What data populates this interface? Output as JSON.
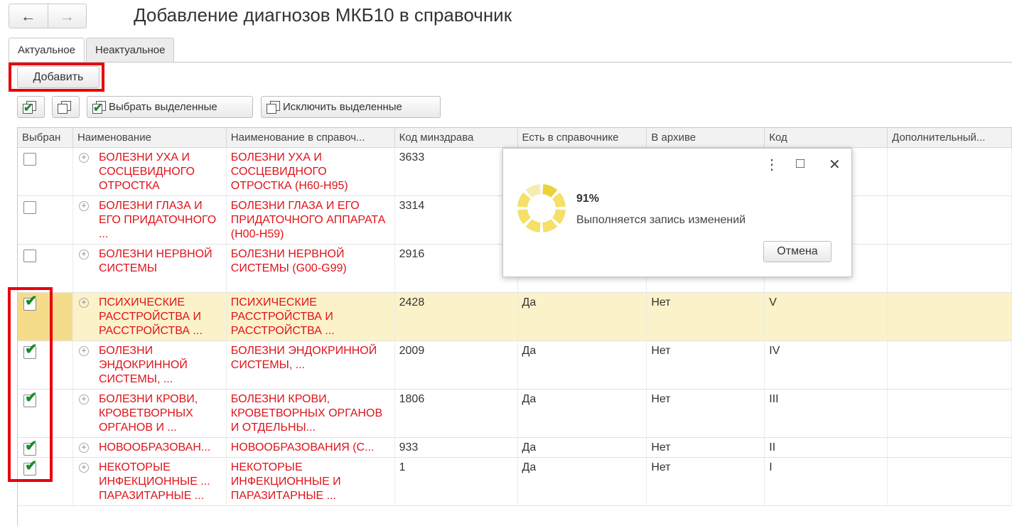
{
  "window": {
    "title": "Добавление диагнозов МКБ10 в справочник",
    "back_icon": "←",
    "forward_icon": "→"
  },
  "tabs": [
    {
      "label": "Актуальное"
    },
    {
      "label": "Неактуальное"
    }
  ],
  "toolbar": {
    "add_label": "Добавить",
    "select_selected_label": "Выбрать выделенные",
    "exclude_selected_label": "Исключить выделенные"
  },
  "columns": [
    "Выбран",
    "Наименование",
    "Наименование в справоч...",
    "Код минздрава",
    "Есть в справочнике",
    "В архиве",
    "Код",
    "Дополнительный..."
  ],
  "rows": [
    {
      "checked": false,
      "name": "БОЛЕЗНИ УХА И СОСЦЕВИДНОГО ОТРОСТКА",
      "ref_name": "БОЛЕЗНИ УХА И СОСЦЕВИДНОГО ОТРОСТКА (H60-H95)",
      "mz_code": "3633",
      "in_ref": "",
      "archive": "",
      "code": ""
    },
    {
      "checked": false,
      "name": "БОЛЕЗНИ ГЛАЗА И ЕГО ПРИДАТОЧНОГО ...",
      "ref_name": "БОЛЕЗНИ ГЛАЗА И ЕГО ПРИДАТОЧНОГО АППАРАТА (H00-H59)",
      "mz_code": "3314",
      "in_ref": "",
      "archive": "",
      "code": ""
    },
    {
      "checked": false,
      "name": "БОЛЕЗНИ НЕРВНОЙ СИСТЕМЫ",
      "ref_name": "БОЛЕЗНИ НЕРВНОЙ СИСТЕМЫ (G00-G99)",
      "mz_code": "2916",
      "in_ref": "",
      "archive": "",
      "code": ""
    },
    {
      "checked": true,
      "name": "ПСИХИЧЕСКИЕ РАССТРОЙСТВА И РАССТРОЙСТВА ...",
      "ref_name": "ПСИХИЧЕСКИЕ РАССТРОЙСТВА И РАССТРОЙСТВА ...",
      "mz_code": "2428",
      "in_ref": "Да",
      "archive": "Нет",
      "code": "V"
    },
    {
      "checked": true,
      "name": "БОЛЕЗНИ ЭНДОКРИННОЙ СИСТЕМЫ, ...",
      "ref_name": "БОЛЕЗНИ ЭНДОКРИННОЙ СИСТЕМЫ, ...",
      "mz_code": "2009",
      "in_ref": "Да",
      "archive": "Нет",
      "code": "IV"
    },
    {
      "checked": true,
      "name": "БОЛЕЗНИ КРОВИ, КРОВЕТВОРНЫХ ОРГАНОВ И ...",
      "ref_name": "БОЛЕЗНИ КРОВИ, КРОВЕТВОРНЫХ ОРГАНОВ И ОТДЕЛЬНЫ...",
      "mz_code": "1806",
      "in_ref": "Да",
      "archive": "Нет",
      "code": "III"
    },
    {
      "checked": true,
      "name": "НОВООБРАЗОВАН...",
      "ref_name": "НОВООБРАЗОВАНИЯ (С...",
      "mz_code": "933",
      "in_ref": "Да",
      "archive": "Нет",
      "code": "II"
    },
    {
      "checked": true,
      "name": "НЕКОТОРЫЕ ИНФЕКЦИОННЫЕ ... ПАРАЗИТАРНЫЕ ...",
      "ref_name": "НЕКОТОРЫЕ ИНФЕКЦИОННЫЕ И ПАРАЗИТАРНЫЕ ...",
      "mz_code": "1",
      "in_ref": "Да",
      "archive": "Нет",
      "code": "I"
    }
  ],
  "dialog": {
    "percent": "91%",
    "progress_value": 91,
    "message": "Выполняется запись изменений",
    "cancel_label": "Отмена",
    "more_icon": "⋮",
    "maximize_icon": "□",
    "close_icon": "✕"
  },
  "colors": {
    "accent_red": "#e0131a",
    "highlight_frame": "#e8000c",
    "selected_row": "#fbf2c9",
    "check_green": "#1b8a2e",
    "spinner": "#f4e06a"
  }
}
